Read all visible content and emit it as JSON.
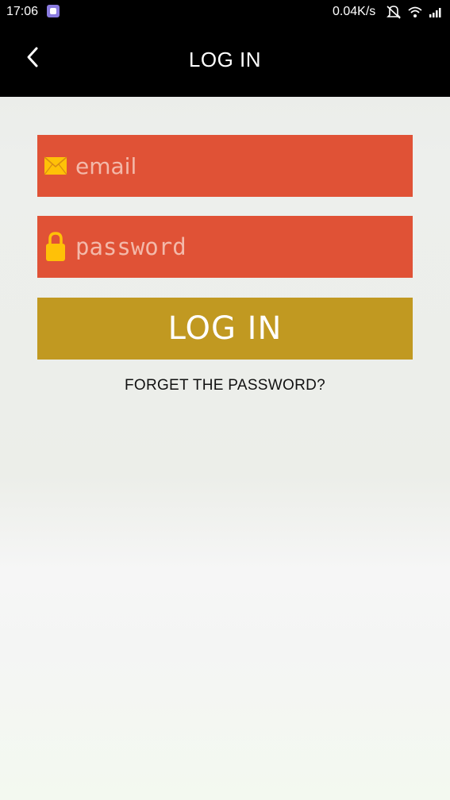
{
  "status_bar": {
    "time": "17:06",
    "net_speed": "0.04K/s",
    "app_icon": "app-notification-icon",
    "icons": [
      "mute-icon",
      "wifi-icon",
      "signal-icon"
    ]
  },
  "app_bar": {
    "title": "LOG IN",
    "back_icon": "chevron-left-icon"
  },
  "form": {
    "email_placeholder": "email",
    "email_value": "",
    "email_icon": "envelope-icon",
    "password_placeholder": "password",
    "password_value": "",
    "password_icon": "lock-icon",
    "login_label": "LOG IN",
    "forgot_label": "FORGET THE PASSWORD?"
  },
  "colors": {
    "field_bg": "#e05236",
    "button_bg": "#c19921",
    "icon_yellow": "#ffc107",
    "progress": "#32c832"
  }
}
